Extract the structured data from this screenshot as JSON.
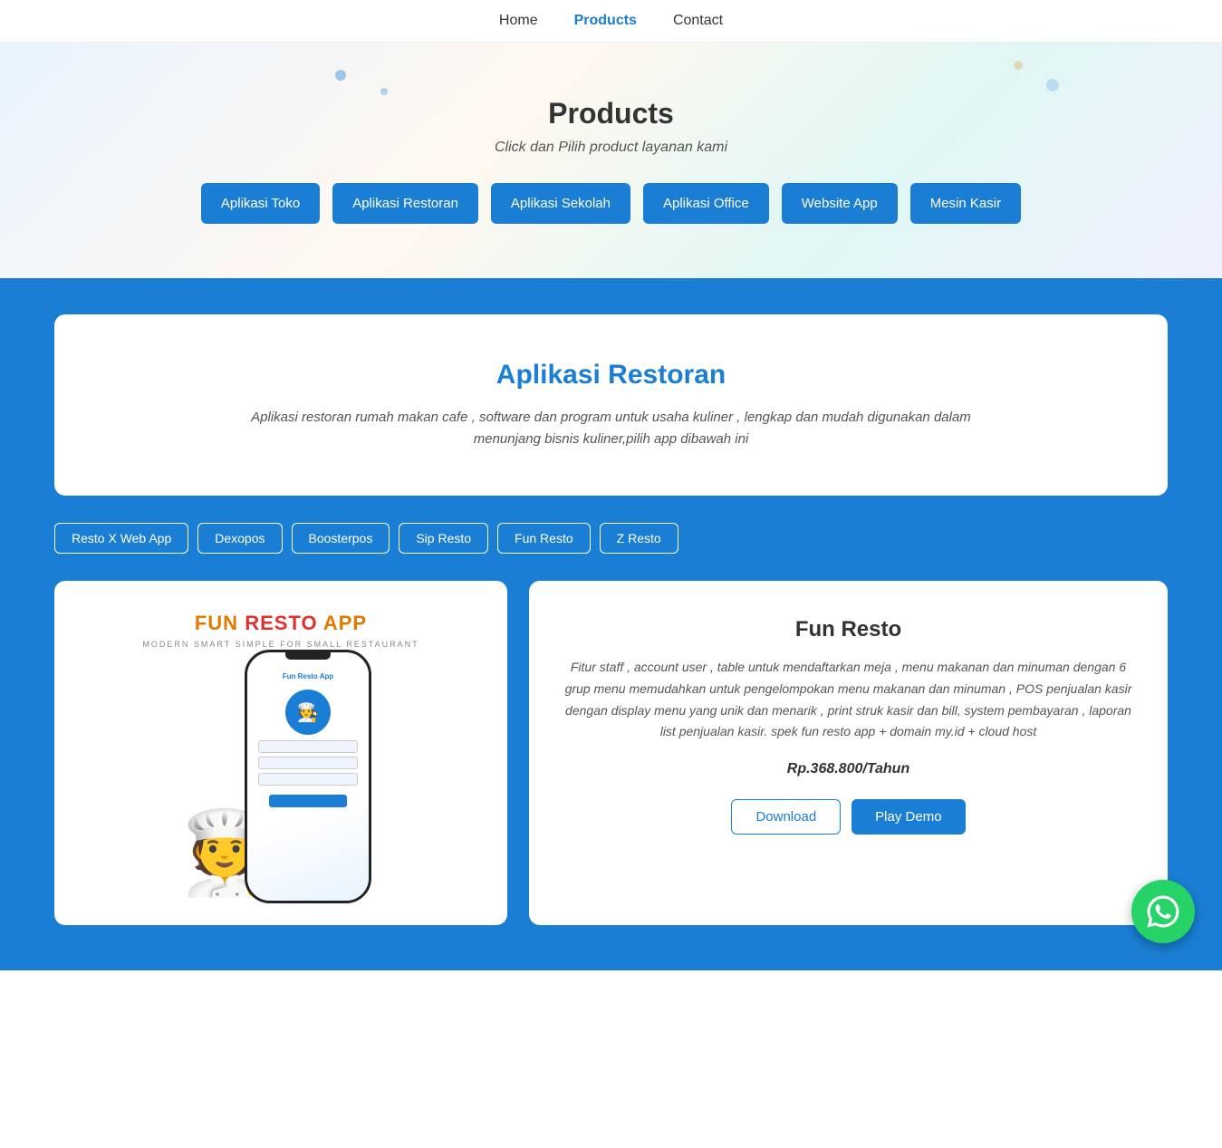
{
  "nav": {
    "links": [
      {
        "label": "Home",
        "active": false
      },
      {
        "label": "Products",
        "active": true
      },
      {
        "label": "Contact",
        "active": false
      }
    ]
  },
  "hero": {
    "title": "Products",
    "subtitle": "Click dan Pilih product layanan kami",
    "buttons": [
      {
        "label": "Aplikasi Toko"
      },
      {
        "label": "Aplikasi Restoran"
      },
      {
        "label": "Aplikasi Sekolah"
      },
      {
        "label": "Aplikasi Office"
      },
      {
        "label": "Website App"
      },
      {
        "label": "Mesin Kasir"
      }
    ]
  },
  "restoran_section": {
    "card_title": "Aplikasi Restoran",
    "card_description": "Aplikasi restoran rumah makan cafe , software dan program untuk usaha kuliner , lengkap dan mudah digunakan dalam menunjang bisnis kuliner,pilih app dibawah ini",
    "sub_nav": [
      {
        "label": "Resto X Web App"
      },
      {
        "label": "Dexopos"
      },
      {
        "label": "Boosterpos"
      },
      {
        "label": "Sip Resto"
      },
      {
        "label": "Fun Resto"
      },
      {
        "label": "Z Resto"
      }
    ]
  },
  "product": {
    "name": "Fun Resto",
    "app_logo_main": "FUN",
    "app_logo_accent": "RESTO",
    "app_logo_label": "APP",
    "app_subtitle": "MODERN SMART SIMPLE FOR SMALL RESTAURANT",
    "app_screen_label": "Fun Resto App",
    "description": "Fitur staff , account user , table untuk mendaftarkan meja , menu makanan dan minuman dengan 6 grup menu memudahkan untuk pengelompokan menu makanan dan minuman , POS penjualan kasir dengan display menu yang unik dan menarik , print struk kasir dan bill, system pembayaran , laporan list penjualan kasir. spek fun resto app + domain my.id + cloud host",
    "price": "Rp.368.800/Tahun",
    "btn_download": "Download",
    "btn_play_demo": "Play Demo"
  },
  "whatsapp": {
    "aria": "whatsapp-contact"
  }
}
